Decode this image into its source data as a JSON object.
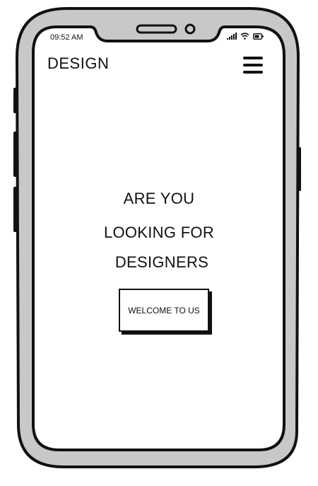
{
  "status_bar": {
    "time": "09:52 AM",
    "icons": [
      "signal-icon",
      "wifi-icon",
      "battery-icon"
    ]
  },
  "header": {
    "brand": "DESIGN",
    "menu_icon": "hamburger-menu-icon"
  },
  "hero": {
    "line1": "ARE YOU",
    "line2": "LOOKING FOR",
    "line3": "DESIGNERS",
    "cta_label": "WELCOME TO US"
  },
  "colors": {
    "frame_fill": "#c8c8c8",
    "ink": "#111111",
    "screen": "#ffffff"
  }
}
